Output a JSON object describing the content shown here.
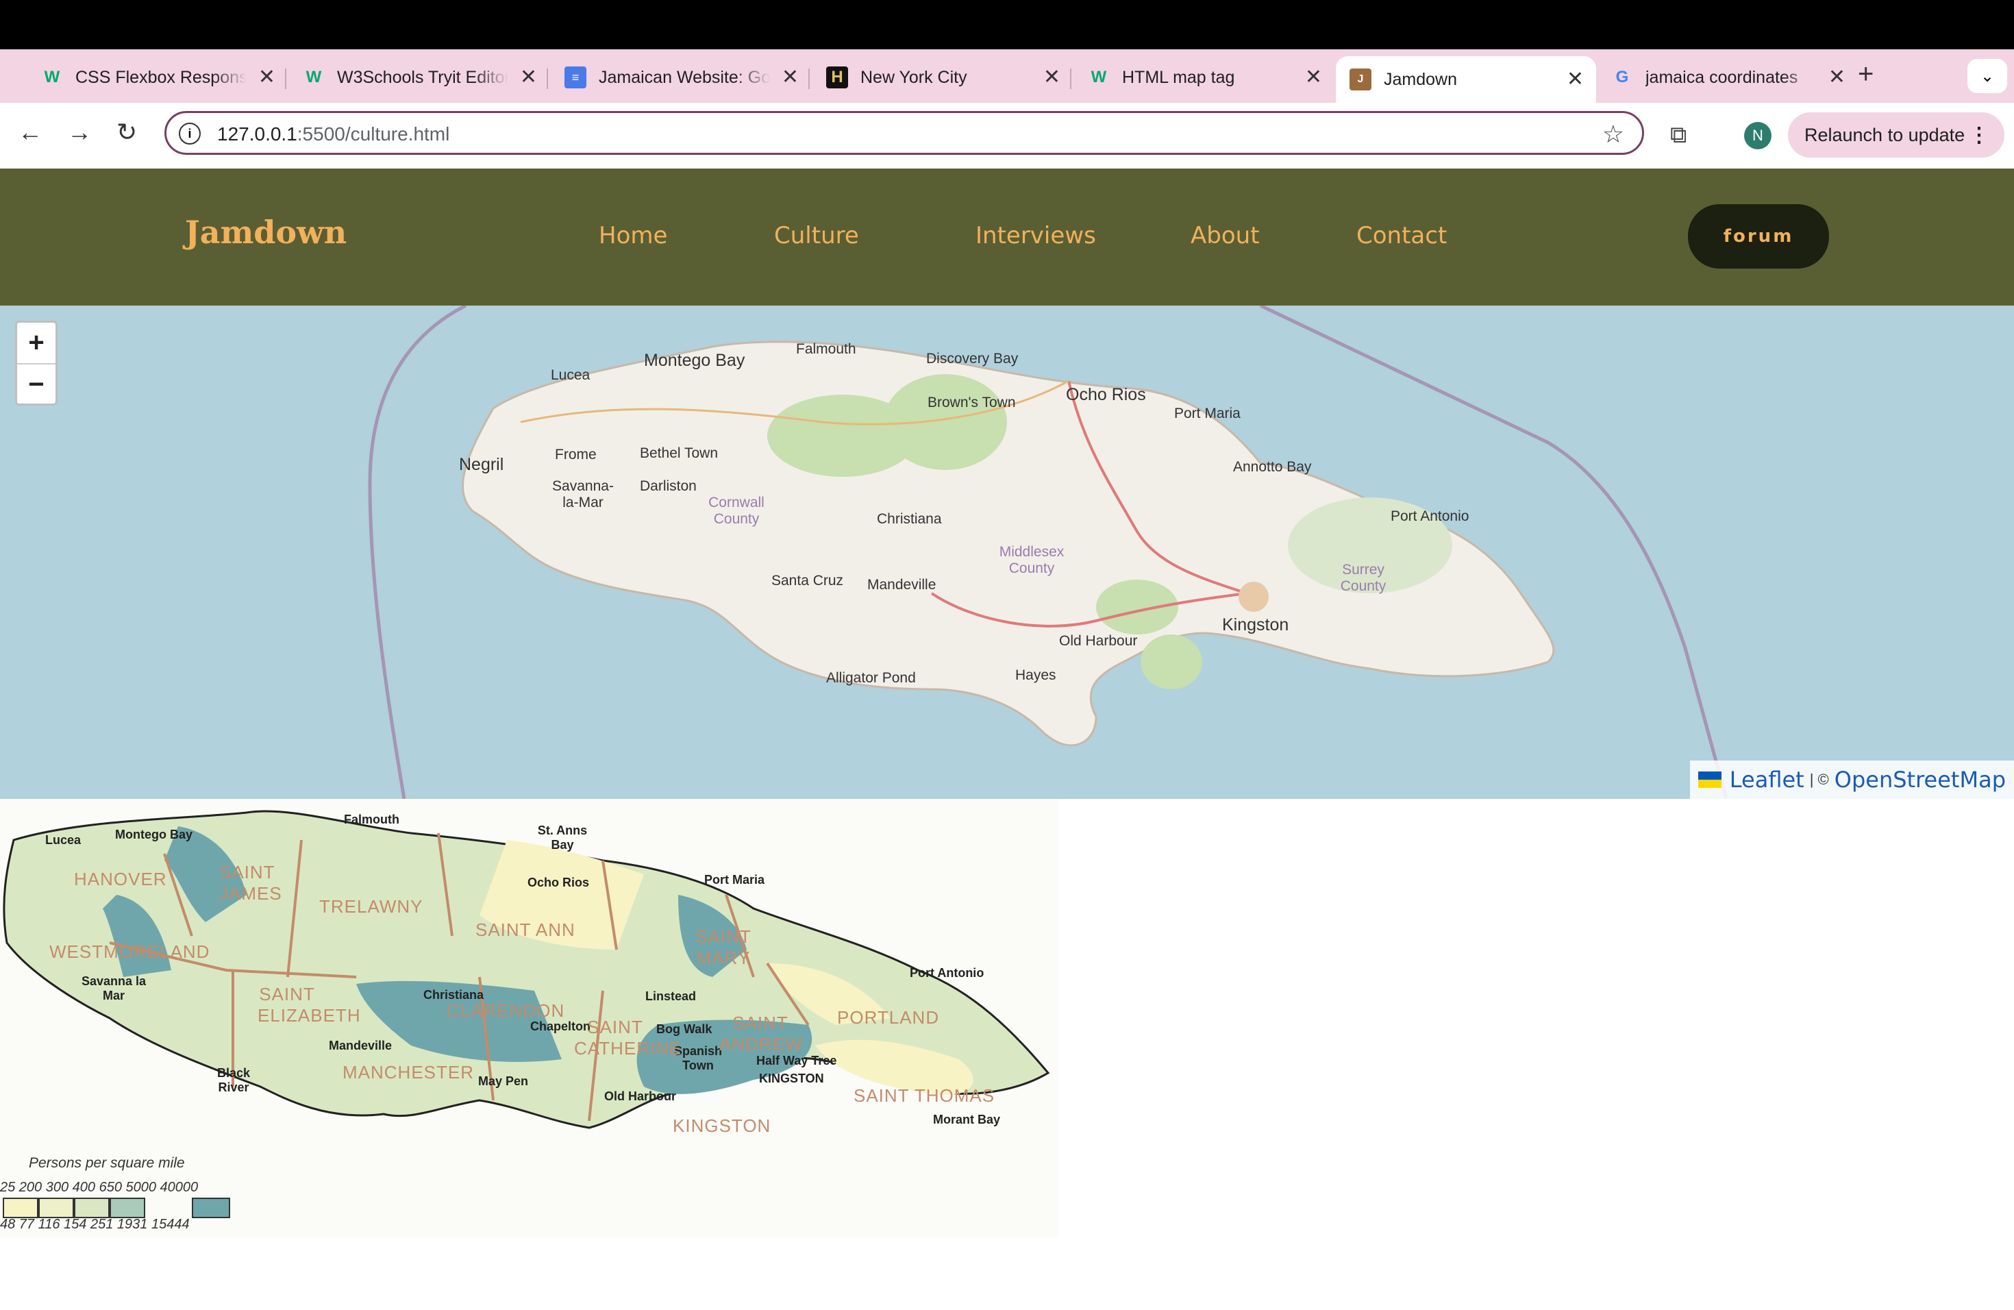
{
  "browser": {
    "tabs": [
      {
        "title": "CSS Flexbox Responsive",
        "favicon": "w3schools-icon"
      },
      {
        "title": "W3Schools Tryit Editor",
        "favicon": "w3schools-icon"
      },
      {
        "title": "Jamaican Website: Google Docs",
        "favicon": "google-docs-icon"
      },
      {
        "title": "New York City",
        "favicon": "history-icon"
      },
      {
        "title": "HTML map tag",
        "favicon": "w3schools-icon"
      },
      {
        "title": "Jamdown",
        "favicon": "site-icon"
      },
      {
        "title": "jamaica coordinates",
        "favicon": "google-icon"
      }
    ],
    "active_tab": 5,
    "url_host": "127.0.0.1",
    "url_path": ":5500/culture.html",
    "avatar_initial": "N",
    "relaunch_label": "Relaunch to update"
  },
  "site": {
    "brand": "Jamdown",
    "nav": [
      "Home",
      "Culture",
      "Interviews",
      "About",
      "Contact"
    ],
    "forum_label": "forum"
  },
  "map": {
    "zoom_in": "+",
    "zoom_out": "−",
    "attribution_leaflet": "Leaflet",
    "attribution_sep": "| ©",
    "attribution_osm": "OpenStreetMap",
    "labels": [
      "Montego Bay",
      "Falmouth",
      "Discovery Bay",
      "Lucea",
      "Brown's Town",
      "Ocho Rios",
      "Port Maria",
      "Negril",
      "Frome",
      "Bethel Town",
      "Annotto Bay",
      "Savanna-la-Mar",
      "Darliston",
      "Cornwall County",
      "Christiana",
      "Port Antonio",
      "Middlesex County",
      "Surrey County",
      "Santa Cruz",
      "Mandeville",
      "Kingston",
      "Old Harbour",
      "Alligator Pond",
      "Hayes"
    ]
  },
  "density_map": {
    "towns": [
      "Lucea",
      "Montego Bay",
      "Falmouth",
      "St. Anns Bay",
      "Ocho Rios",
      "Port Maria",
      "Savanna la Mar",
      "Christiana",
      "Linstead",
      "Port Antonio",
      "Chapelton",
      "Bog Walk",
      "Mandeville",
      "Spanish Town",
      "Half Way Tree",
      "KINGSTON",
      "Black River",
      "May Pen",
      "Old Harbour",
      "Morant Bay"
    ],
    "parishes": [
      "HANOVER",
      "SAINT JAMES",
      "TRELAWNY",
      "SAINT ANN",
      "SAINT MARY",
      "WESTMORELAND",
      "SAINT ELIZABETH",
      "CLARENDON",
      "SAINT CATHERINE",
      "SAINT ANDREW",
      "PORTLAND",
      "MANCHESTER",
      "SAINT THOMAS",
      "KINGSTON"
    ],
    "legend_title": "Persons per square mile",
    "legend_top": "25  200  300  400  650  5000  40000",
    "legend_bottom": "48   77   116   154  251        1931  15444",
    "colors": {
      "low": "#f7f3c4",
      "mid": "#d9e8c2",
      "high": "#6fa6ab"
    }
  }
}
